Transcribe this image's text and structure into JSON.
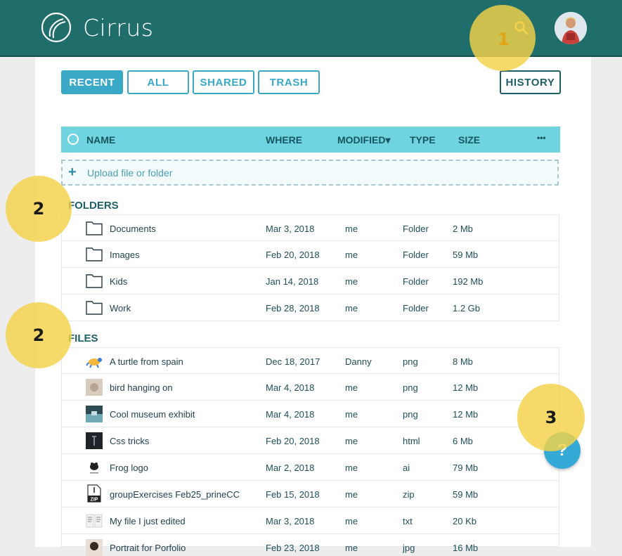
{
  "header": {
    "app_name": "Cirrus"
  },
  "tabs": [
    "RECENT",
    "ALL",
    "SHARED",
    "TRASH"
  ],
  "history_label": "HISTORY",
  "table": {
    "columns": {
      "name": "NAME",
      "where": "WHERE",
      "modified": "MODIFIED▾",
      "type": "TYPE",
      "size": "SIZE",
      "more": "•••"
    }
  },
  "upload_label": "Upload file or folder",
  "sections": {
    "folders": "FOLDERS",
    "files": "FILES"
  },
  "folders": [
    {
      "name": "Documents",
      "date": "Mar 3, 2018",
      "owner": "me",
      "type": "Folder",
      "size": "2 Mb"
    },
    {
      "name": "Images",
      "date": "Feb 20, 2018",
      "owner": "me",
      "type": "Folder",
      "size": "59 Mb"
    },
    {
      "name": "Kids",
      "date": "Jan 14, 2018",
      "owner": "me",
      "type": "Folder",
      "size": "192 Mb"
    },
    {
      "name": "Work",
      "date": "Feb 28, 2018",
      "owner": "me",
      "type": "Folder",
      "size": "1.2 Gb"
    }
  ],
  "files": [
    {
      "name": "A turtle from spain",
      "date": "Dec 18, 2017",
      "owner": "Danny",
      "type": "png",
      "size": "8 Mb",
      "icon": "turtle-thumbnail-icon"
    },
    {
      "name": "bird hanging on",
      "date": "Mar 4, 2018",
      "owner": "me",
      "type": "png",
      "size": "12 Mb",
      "icon": "bird-thumbnail-icon"
    },
    {
      "name": "Cool museum exhibit",
      "date": "Mar 4, 2018",
      "owner": "me",
      "type": "png",
      "size": "12 Mb",
      "icon": "museum-thumbnail-icon"
    },
    {
      "name": "Css tricks",
      "date": "Feb 20, 2018",
      "owner": "me",
      "type": "html",
      "size": "6 Mb",
      "icon": "css-thumbnail-icon"
    },
    {
      "name": "Frog logo",
      "date": "Mar 2, 2018",
      "owner": "me",
      "type": "ai",
      "size": "79 Mb",
      "icon": "frog-thumbnail-icon"
    },
    {
      "name": "groupExercises Feb25_prineCC",
      "date": "Feb 15, 2018",
      "owner": "me",
      "type": "zip",
      "size": "59 Mb",
      "icon": "zip-file-icon"
    },
    {
      "name": "My file I just edited",
      "date": "Mar 3, 2018",
      "owner": "me",
      "type": "txt",
      "size": "20 Kb",
      "icon": "document-thumbnail-icon"
    },
    {
      "name": "Portrait for Porfolio",
      "date": "Feb 23, 2018",
      "owner": "me",
      "type": "jpg",
      "size": "16 Mb",
      "icon": "portrait-thumbnail-icon"
    }
  ],
  "annotations": [
    "1",
    "2",
    "2",
    "3"
  ],
  "help_label": "?",
  "colors": {
    "header": "#1f6e6c",
    "accent": "#3aa9c8",
    "table_header": "#6fd4e0",
    "highlight": "#f4d248"
  }
}
